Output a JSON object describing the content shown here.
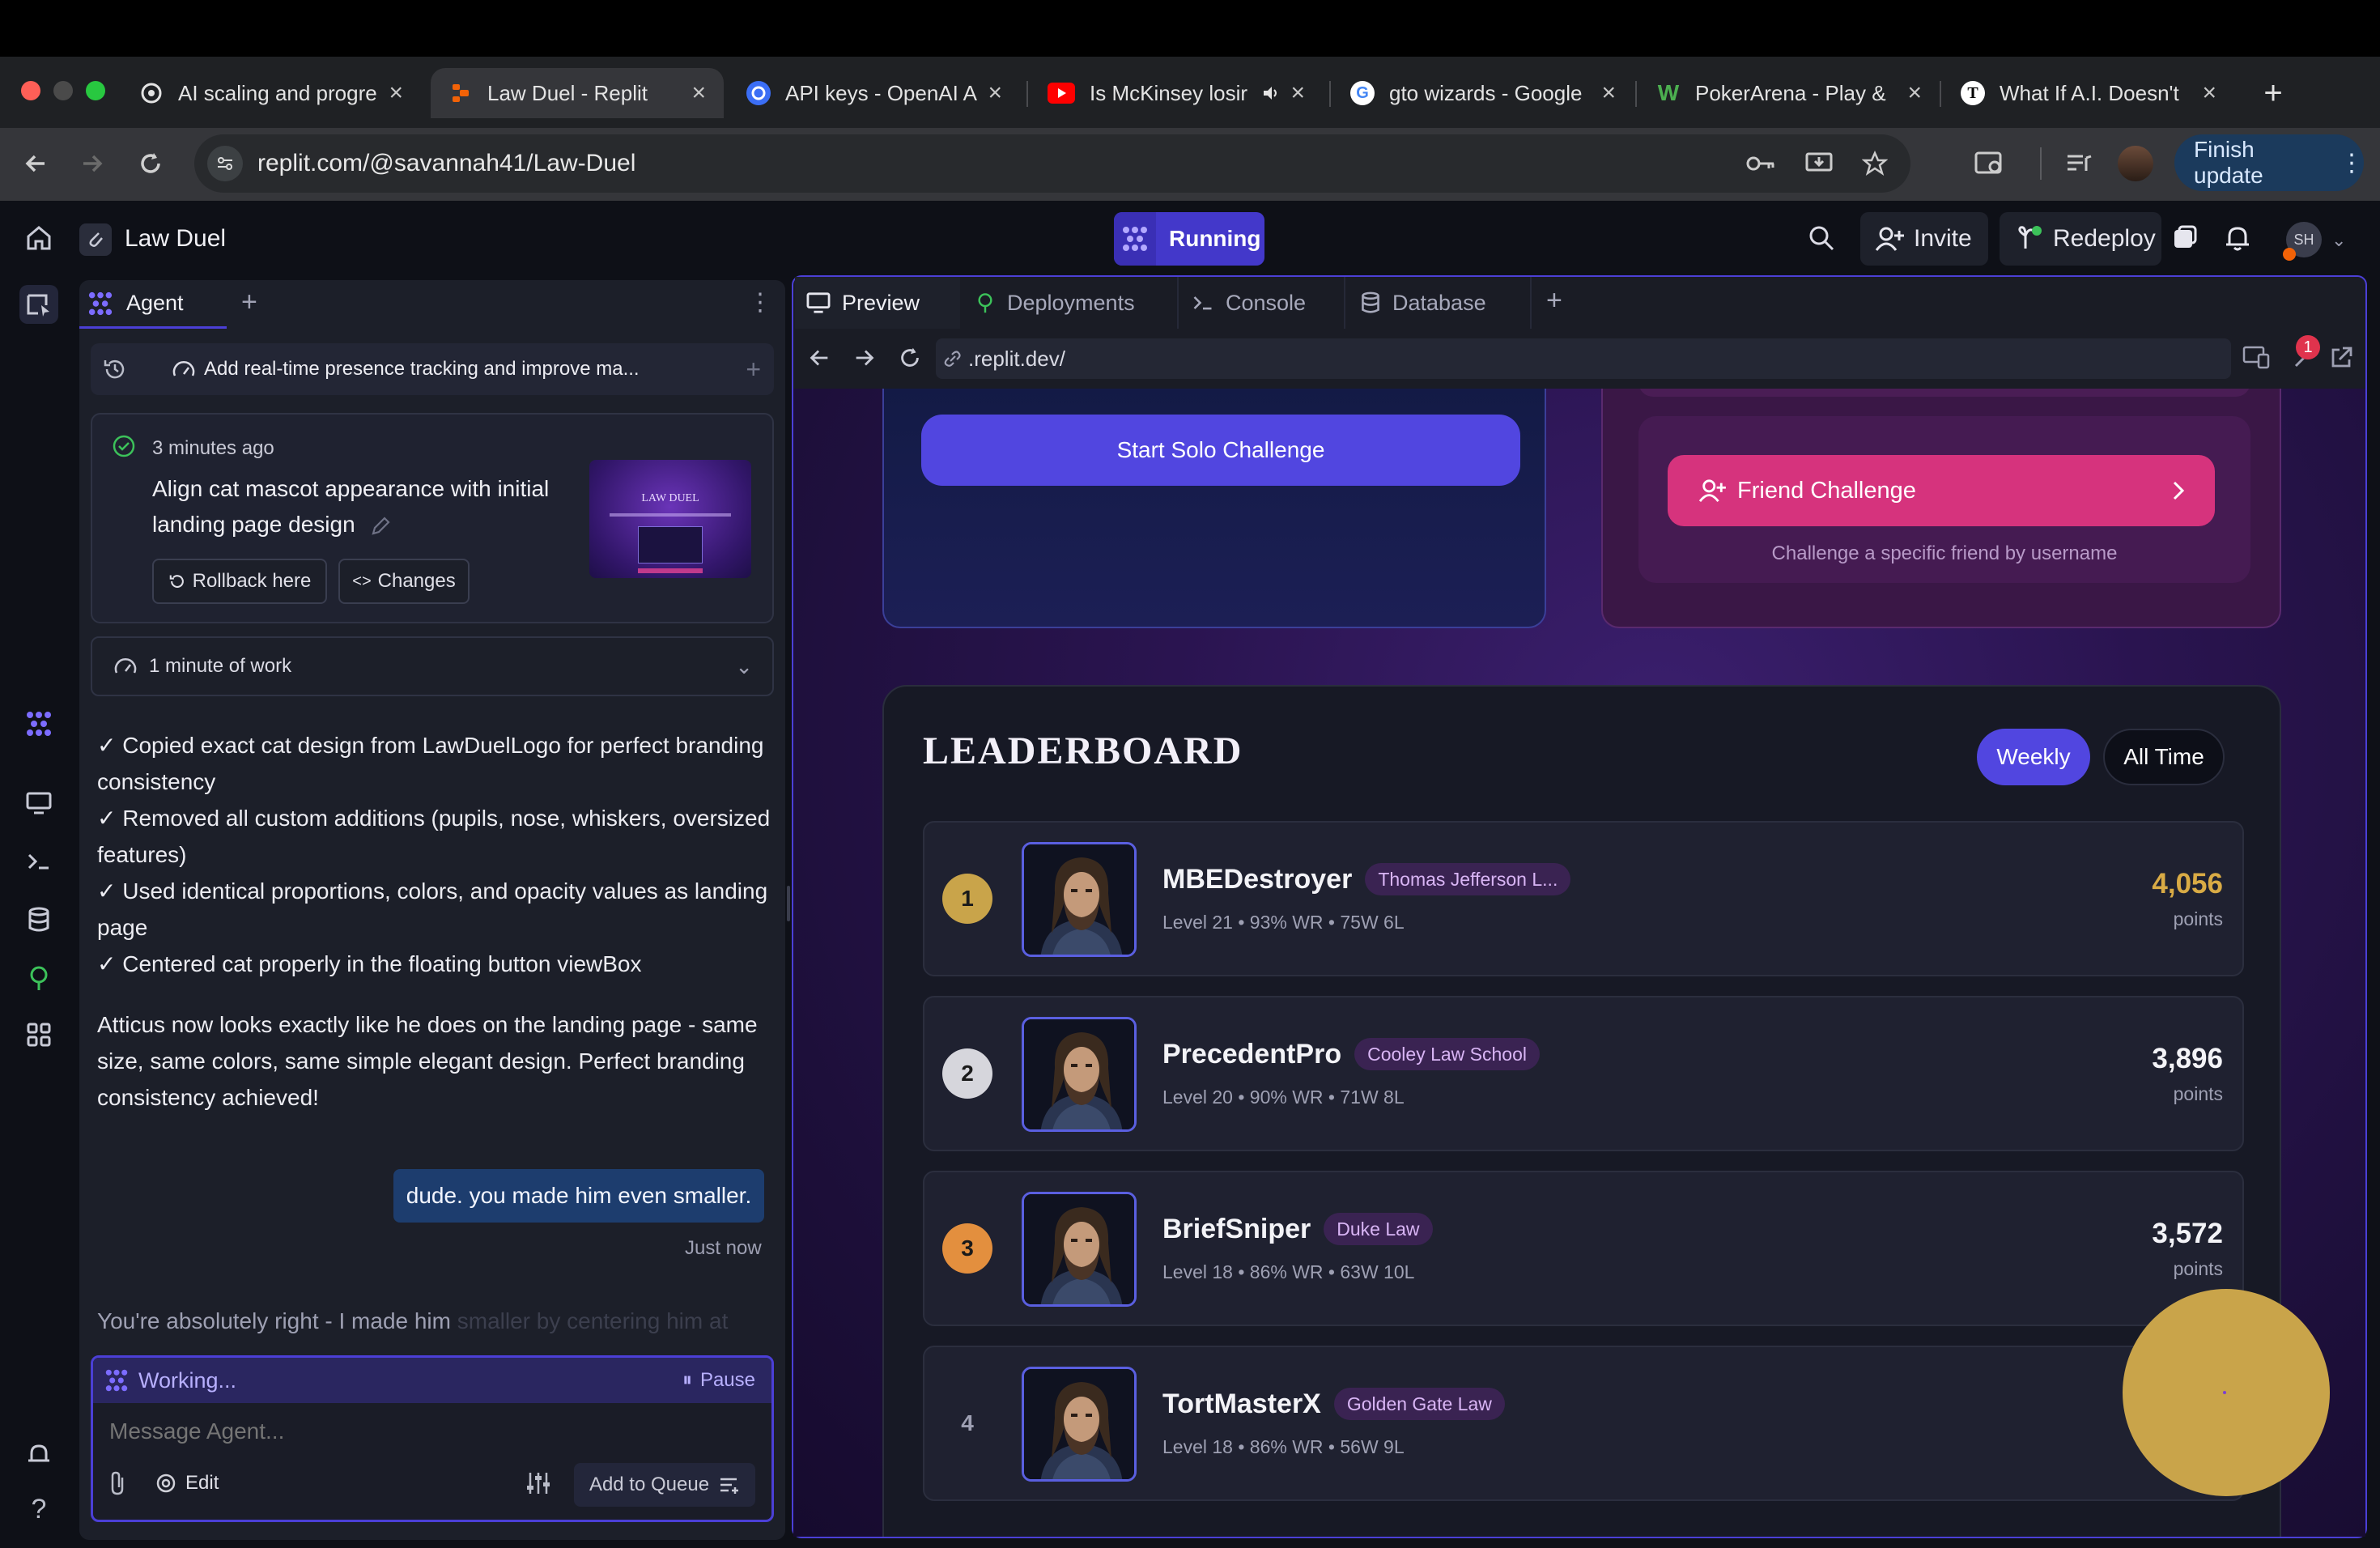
{
  "browser": {
    "tabs": [
      {
        "title": "AI scaling and progre",
        "icon": "openai-icon",
        "active": false
      },
      {
        "title": "Law Duel - Replit",
        "icon": "replit-icon",
        "active": true
      },
      {
        "title": "API keys - OpenAI A",
        "icon": "openai-icon",
        "active": false
      },
      {
        "title": "Is McKinsey losir",
        "icon": "youtube-icon",
        "active": false
      },
      {
        "title": "gto wizards - Google",
        "icon": "google-icon",
        "active": false
      },
      {
        "title": "PokerArena - Play &",
        "icon": "w-icon",
        "active": false
      },
      {
        "title": "What If A.I. Doesn't",
        "icon": "nyt-icon",
        "active": false
      }
    ],
    "new_tab": "+",
    "url": "replit.com/@savannah41/Law-Duel",
    "finish_update": "Finish update"
  },
  "replit": {
    "project_name": "Law Duel",
    "run_status": "Running",
    "invite": "Invite",
    "redeploy": "Redeploy",
    "avatar_initials": "SH"
  },
  "agent": {
    "tab_label": "Agent",
    "add_tab": "+",
    "thread_title": "Add real-time presence tracking and improve ma...",
    "checkpoint": {
      "time": "3 minutes ago",
      "title": "Align cat mascot appearance with initial landing page design",
      "rollback": "Rollback here",
      "changes": "Changes",
      "thumb_title": "LAW DUEL"
    },
    "work_summary": "1 minute of work",
    "bullets": [
      "✓ Copied exact cat design from LawDuelLogo for perfect branding consistency",
      "✓ Removed all custom additions (pupils, nose, whiskers, oversized features)",
      "✓ Used identical proportions, colors, and opacity values as landing page",
      "✓ Centered cat properly in the floating button viewBox"
    ],
    "summary_paragraph": "Atticus now looks exactly like he does on the landing page - same size, same colors, same simple elegant design. Perfect branding consistency achieved!",
    "user_message": "dude. you made him even smaller.",
    "user_message_time": "Just now",
    "streaming_visible": "You're absolutely right - I made him",
    "streaming_faded": "smaller by centering him at",
    "working_label": "Working...",
    "pause_label": "Pause",
    "input_placeholder": "Message Agent...",
    "edit_label": "Edit",
    "queue_label": "Add to Queue"
  },
  "preview": {
    "tabs": [
      {
        "label": "Preview",
        "icon": "monitor-icon"
      },
      {
        "label": "Deployments",
        "icon": "deploy-icon"
      },
      {
        "label": "Console",
        "icon": "terminal-icon"
      },
      {
        "label": "Database",
        "icon": "database-icon"
      }
    ],
    "add_tab": "+",
    "url": ".replit.dev/",
    "notification_count": "1"
  },
  "site": {
    "solo_button": "Start Solo Challenge",
    "friend_button": "Friend Challenge",
    "friend_caption": "Challenge a specific friend by username",
    "leaderboard_title": "LEADERBOARD",
    "filters": [
      "Weekly",
      "All Time"
    ],
    "active_filter": "Weekly",
    "entries": [
      {
        "rank": "1",
        "name": "MBEDestroyer",
        "school": "Thomas Jefferson L...",
        "stats": "Level 21 • 93% WR • 75W 6L",
        "points": "4,056",
        "points_label": "points",
        "rank_color": "#c9a44a",
        "points_color": "#d9ab45"
      },
      {
        "rank": "2",
        "name": "PrecedentPro",
        "school": "Cooley Law School",
        "stats": "Level 20 • 90% WR • 71W 8L",
        "points": "3,896",
        "points_label": "points",
        "rank_color": "#d6d6dc",
        "points_color": "#f3f3f7"
      },
      {
        "rank": "3",
        "name": "BriefSniper",
        "school": "Duke Law",
        "stats": "Level 18 • 86% WR • 63W 10L",
        "points": "3,572",
        "points_label": "points",
        "rank_color": "#e38f3e",
        "points_color": "#f3f3f7"
      },
      {
        "rank": "4",
        "name": "TortMasterX",
        "school": "Golden Gate Law",
        "stats": "Level 18 • 86% WR • 56W 9L",
        "points": "",
        "points_label": "",
        "rank_color": "",
        "points_color": "#f3f3f7"
      }
    ]
  },
  "colors": {
    "accent": "#5146e0",
    "friend_pink": "#d6337d",
    "gold_fab": "#c9a44a"
  }
}
